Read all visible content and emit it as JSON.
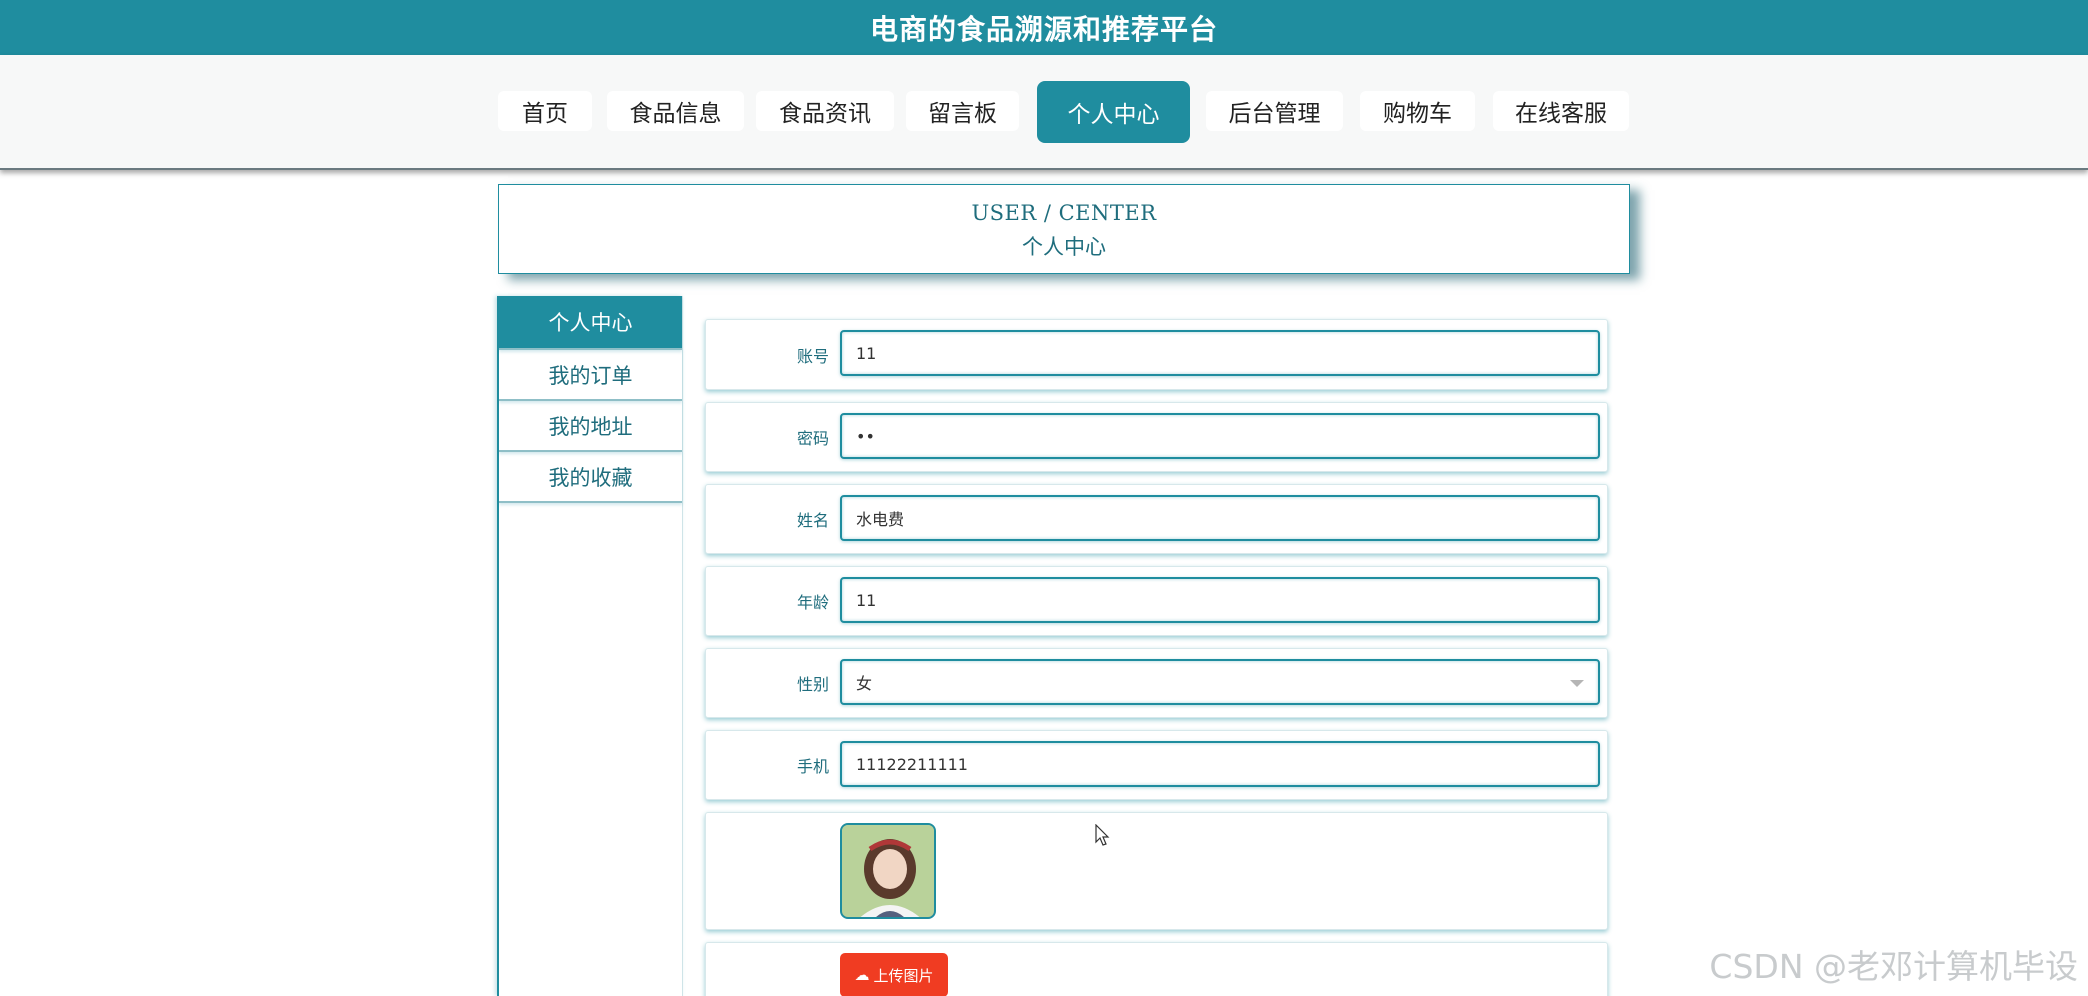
{
  "site": {
    "title": "电商的食品溯源和推荐平台"
  },
  "nav": {
    "items": [
      {
        "label": "首页"
      },
      {
        "label": "食品信息"
      },
      {
        "label": "食品资讯"
      },
      {
        "label": "留言板"
      },
      {
        "label": "个人中心"
      },
      {
        "label": "后台管理"
      },
      {
        "label": "购物车"
      },
      {
        "label": "在线客服"
      }
    ],
    "active": "个人中心"
  },
  "header": {
    "en_title": "USER / CENTER",
    "cn_title": "个人中心"
  },
  "sidebar": {
    "items": [
      {
        "label": "个人中心"
      },
      {
        "label": "我的订单"
      },
      {
        "label": "我的地址"
      },
      {
        "label": "我的收藏"
      }
    ],
    "active": "个人中心"
  },
  "form": {
    "account": {
      "label": "账号",
      "value": "11"
    },
    "password": {
      "label": "密码",
      "value": "••"
    },
    "name": {
      "label": "姓名",
      "value": "水电费"
    },
    "age": {
      "label": "年龄",
      "value": "11"
    },
    "gender": {
      "label": "性别",
      "value": "女"
    },
    "phone": {
      "label": "手机",
      "value": "11122211111"
    },
    "upload_label": "上传图片"
  },
  "watermark": "CSDN @老邓计算机毕设",
  "colors": {
    "primary": "#1f8d9f",
    "upload": "#f03c22"
  }
}
